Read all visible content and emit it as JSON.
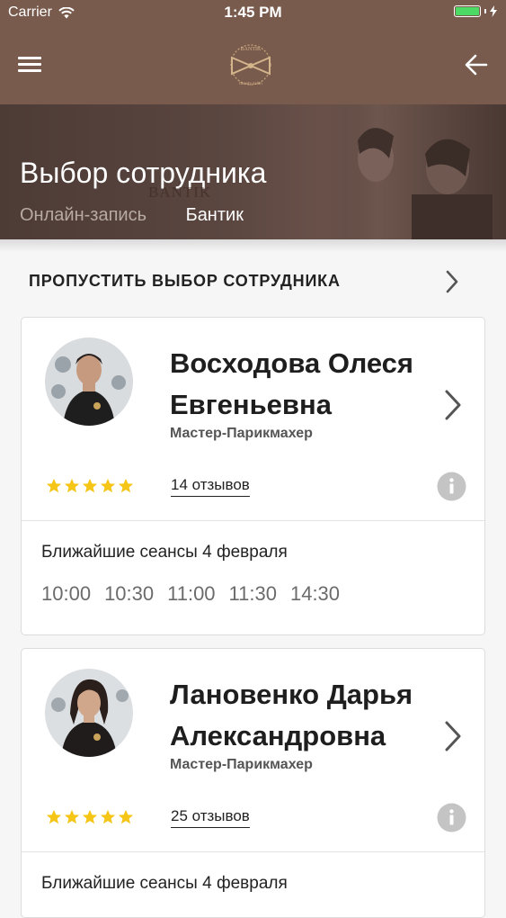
{
  "status_bar": {
    "carrier": "Carrier",
    "time": "1:45 PM",
    "battery_color": "#4cd964"
  },
  "nav_bar": {
    "background_color": "#795b4e",
    "menu_icon": "hamburger-icon",
    "logo_icon": "bantik-logo",
    "back_icon": "arrow-left-icon"
  },
  "header": {
    "title": "Выбор сотрудника",
    "watermark": "BANTIK",
    "tabs": [
      {
        "label": "Онлайн-запись"
      },
      {
        "label": "Бантик"
      }
    ]
  },
  "skip": {
    "label": "ПРОПУСТИТЬ ВЫБОР СОТРУДНИКА",
    "icon": "chevron-right-icon"
  },
  "employees": [
    {
      "name": "Восходова Олеся Евгеньевна",
      "role": "Мастер-Парикмахер",
      "rating": 5,
      "reviews": "14 отзывов",
      "sessions_title": "Ближайшие сеансы 4 февраля",
      "times": [
        "10:00",
        "10:30",
        "11:00",
        "11:30",
        "14:30"
      ]
    },
    {
      "name": "Лановенко Дарья Александровна",
      "role": "Мастер-Парикмахер",
      "rating": 5,
      "reviews": "25 отзывов",
      "sessions_title": "Ближайшие сеансы 4 февраля",
      "times": []
    }
  ],
  "colors": {
    "accent": "#795b4e",
    "star": "#f5c518",
    "info_icon": "#c4c4c4"
  }
}
